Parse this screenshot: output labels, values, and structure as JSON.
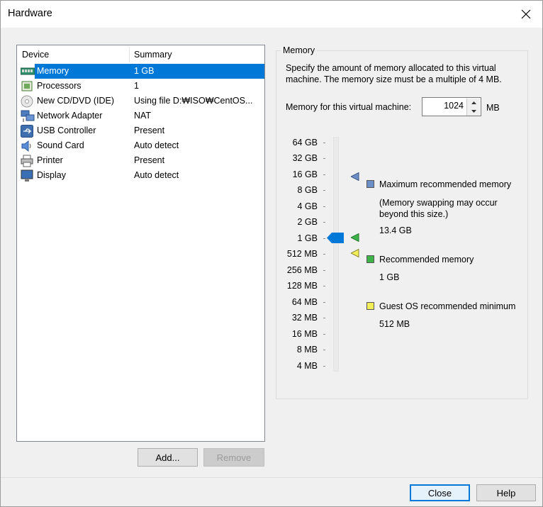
{
  "window": {
    "title": "Hardware"
  },
  "device_list": {
    "headers": {
      "device": "Device",
      "summary": "Summary"
    },
    "rows": [
      {
        "device": "Memory",
        "summary": "1 GB",
        "icon": "memory-icon",
        "selected": true
      },
      {
        "device": "Processors",
        "summary": "1",
        "icon": "processor-icon"
      },
      {
        "device": "New CD/DVD (IDE)",
        "summary": "Using file D:₩ISO₩CentOS...",
        "icon": "cd-dvd-icon"
      },
      {
        "device": "Network Adapter",
        "summary": "NAT",
        "icon": "network-adapter-icon"
      },
      {
        "device": "USB Controller",
        "summary": "Present",
        "icon": "usb-icon"
      },
      {
        "device": "Sound Card",
        "summary": "Auto detect",
        "icon": "speaker-icon"
      },
      {
        "device": "Printer",
        "summary": "Present",
        "icon": "printer-icon"
      },
      {
        "device": "Display",
        "summary": "Auto detect",
        "icon": "monitor-icon"
      }
    ]
  },
  "buttons": {
    "add": "Add...",
    "remove": "Remove",
    "close": "Close",
    "help": "Help"
  },
  "memory": {
    "group_title": "Memory",
    "description": "Specify the amount of memory allocated to this virtual machine. The memory size must be a multiple of 4 MB.",
    "field_label": "Memory for this virtual machine:",
    "value": "1024",
    "unit": "MB",
    "scale": [
      "64 GB",
      "32 GB",
      "16 GB",
      "8 GB",
      "4 GB",
      "2 GB",
      "1 GB",
      "512 MB",
      "256 MB",
      "128 MB",
      "64 MB",
      "32 MB",
      "16 MB",
      "8 MB",
      "4 MB"
    ],
    "slider_value": "1 GB",
    "legend": {
      "max_label": "Maximum recommended memory",
      "max_note": "(Memory swapping may occur beyond this size.)",
      "max_value": "13.4 GB",
      "rec_label": "Recommended memory",
      "rec_value": "1 GB",
      "min_label": "Guest OS recommended minimum",
      "min_value": "512 MB"
    },
    "colors": {
      "max": "#6d8fc7",
      "recommended": "#3cb44a",
      "minimum": "#f2ee5a",
      "thumb": "#0078d7",
      "selection": "#0078d7"
    }
  }
}
